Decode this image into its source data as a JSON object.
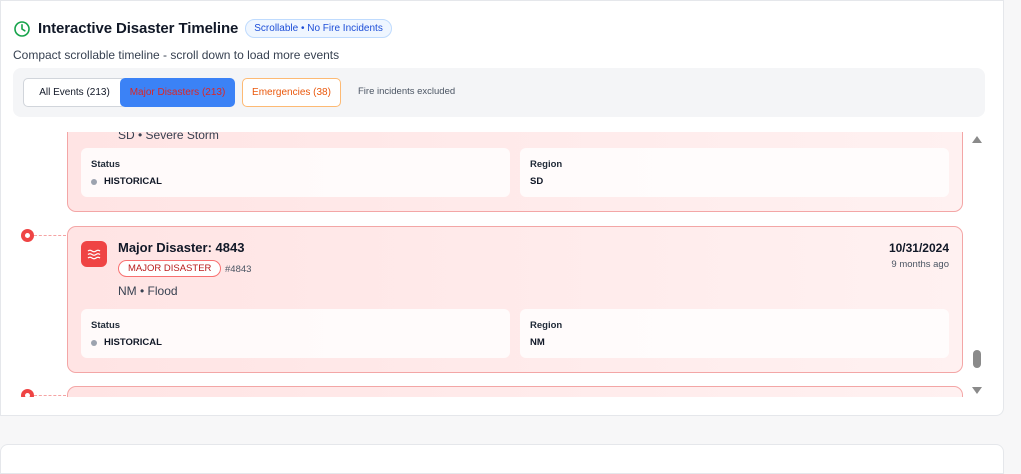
{
  "header": {
    "title": "Interactive Disaster Timeline",
    "badge": "Scrollable • No Fire Incidents",
    "subtitle": "Compact scrollable timeline - scroll down to load more events"
  },
  "filters": {
    "buttons": [
      {
        "label": "All Events (213)",
        "active": false
      },
      {
        "label": "Major Disasters (213)",
        "active": true
      },
      {
        "label": "Emergencies (38)",
        "active": false
      }
    ],
    "note": "Fire incidents excluded"
  },
  "events": [
    {
      "partial_text": "SD • Severe Storm",
      "status_label": "Status",
      "status_value": "HISTORICAL",
      "region_label": "Region",
      "region_value": "SD"
    },
    {
      "icon": "flood-waves-icon",
      "title": "Major Disaster: 4843",
      "type_badge": "MAJOR DISASTER",
      "id": "#4843",
      "location": "NM • Flood",
      "date": "10/31/2024",
      "relative": "9 months ago",
      "status_label": "Status",
      "status_value": "HISTORICAL",
      "region_label": "Region",
      "region_value": "NM"
    }
  ],
  "colors": {
    "accent": "#3b82f6",
    "danger": "#ef4444",
    "card_bg": "#ffe4e4",
    "emergency": "#ea580c",
    "clock_icon": "#16a34a"
  }
}
